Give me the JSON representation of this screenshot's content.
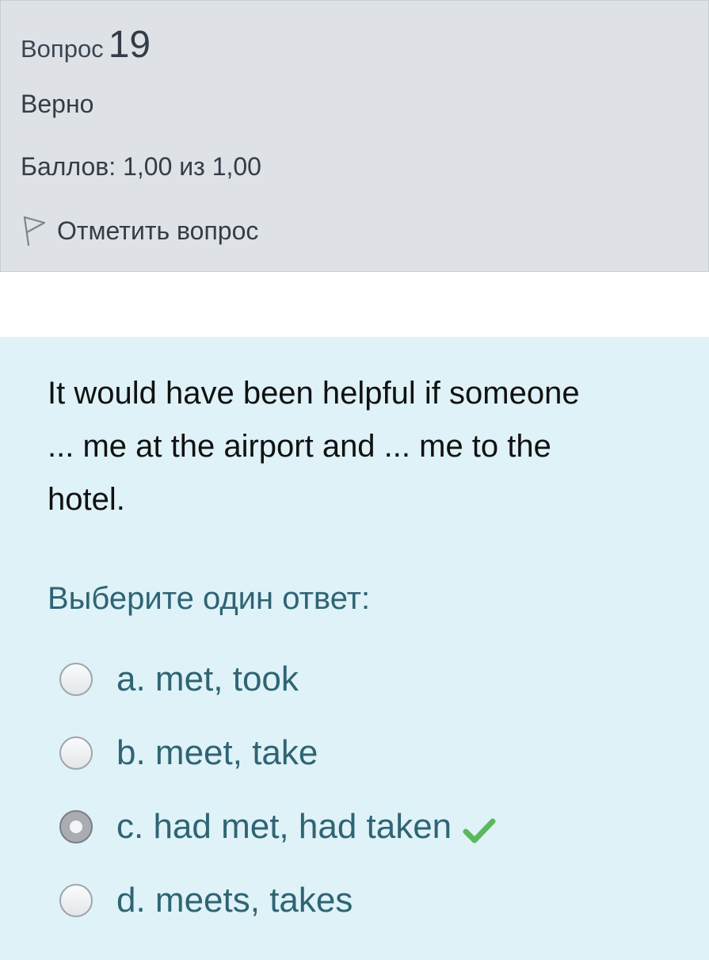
{
  "question": {
    "heading_label": "Вопрос",
    "number": "19",
    "state": "Верно",
    "grade": "Баллов: 1,00 из 1,00",
    "flag_label": "Отметить вопрос",
    "text": "It would have been helpful if someone\n... me at the airport and ...  me to the\nhotel.",
    "prompt": "Выберите один ответ:"
  },
  "answers": [
    {
      "label": "a. met, took",
      "selected": false,
      "correct": false
    },
    {
      "label": "b. meet, take",
      "selected": false,
      "correct": false
    },
    {
      "label": "c. had met, had taken",
      "selected": true,
      "correct": true
    },
    {
      "label": "d. meets, takes",
      "selected": false,
      "correct": false
    }
  ],
  "icons": {
    "flag": "flag-icon",
    "correct": "check-icon"
  },
  "colors": {
    "info_background": "#dee2e6",
    "content_background": "#def2f8",
    "answer_text": "#2f6473",
    "correct_check": "#5cb85c"
  }
}
